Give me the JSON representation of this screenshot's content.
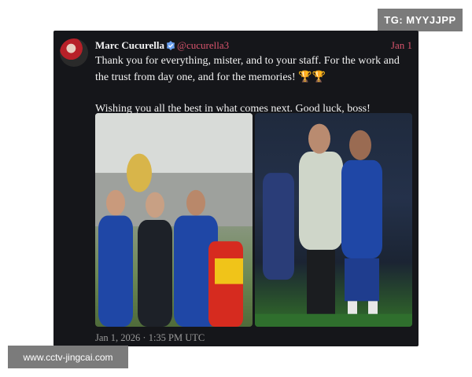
{
  "watermarks": {
    "top": "TG: MYYJJPP",
    "bottom": "www.cctv-jingcai.com"
  },
  "tweet": {
    "author_name": "Marc Cucurella",
    "handle": "@cucurella3",
    "date": "Jan 1",
    "text_line1": "Thank you for everything, mister, and to your staff. For the work and the trust from day one, and for the memories! 🏆🏆",
    "text_line2": "Wishing you all the best in what comes next. Good luck, boss!",
    "timestamp": "Jan 1, 2026 · 1:35 PM UTC"
  },
  "colors": {
    "card_bg": "#15161a",
    "handle": "#d8546c",
    "watermark_bg": "#7b7b7b"
  },
  "icons": {
    "verified": "verified-badge-icon",
    "trophy": "trophy-icon"
  }
}
